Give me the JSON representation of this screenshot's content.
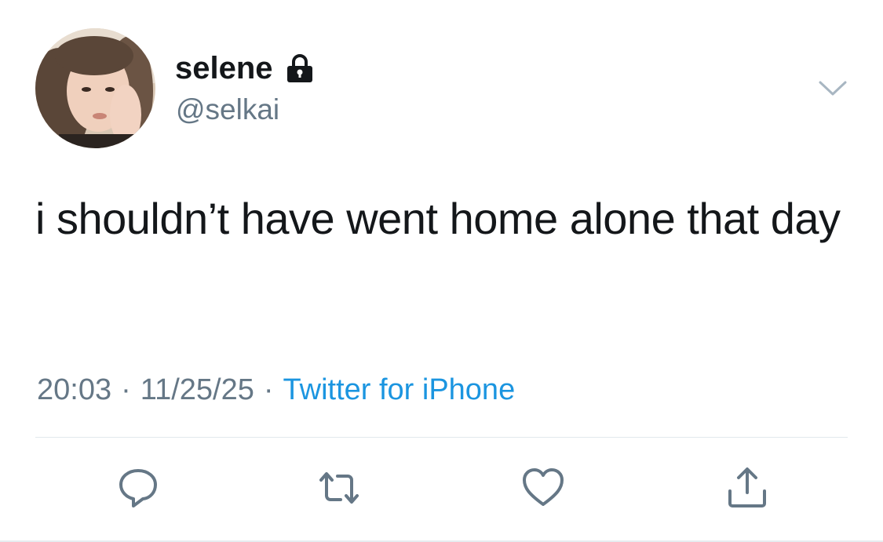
{
  "user": {
    "display_name": "selene",
    "handle": "@selkai",
    "avatar_icon": "profile-photo",
    "locked_icon": "lock-icon"
  },
  "tweet": {
    "text": "i shouldn’t have went home alone that day",
    "time": "20:03",
    "date": "11/25/25",
    "separator": "·",
    "source": "Twitter for iPhone"
  },
  "actions": [
    {
      "icon": "reply-icon"
    },
    {
      "icon": "retweet-icon"
    },
    {
      "icon": "like-icon"
    },
    {
      "icon": "share-icon"
    }
  ],
  "colors": {
    "text": "#14171a",
    "secondary": "#657786",
    "link": "#1b95e0",
    "icon": "#657786",
    "divider": "#e1e8ed"
  }
}
